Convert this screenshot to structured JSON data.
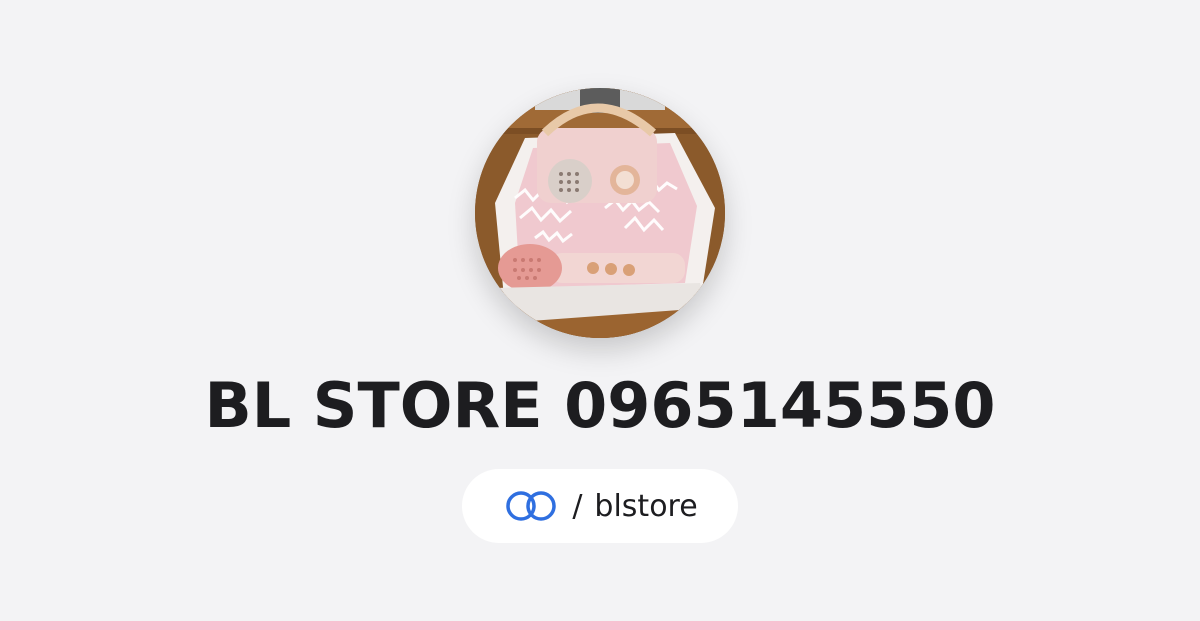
{
  "profile": {
    "avatar_icon": "product-photo-avatar",
    "title": "BL STORE 0965145550",
    "handle_separator": "/",
    "handle": "blstore",
    "link_icon": "linktree-rings-icon"
  },
  "colors": {
    "background": "#f3f3f5",
    "accent_bar": "#f7c2d2",
    "link_icon_blue": "#2f6fe0",
    "text": "#1d1d20"
  }
}
